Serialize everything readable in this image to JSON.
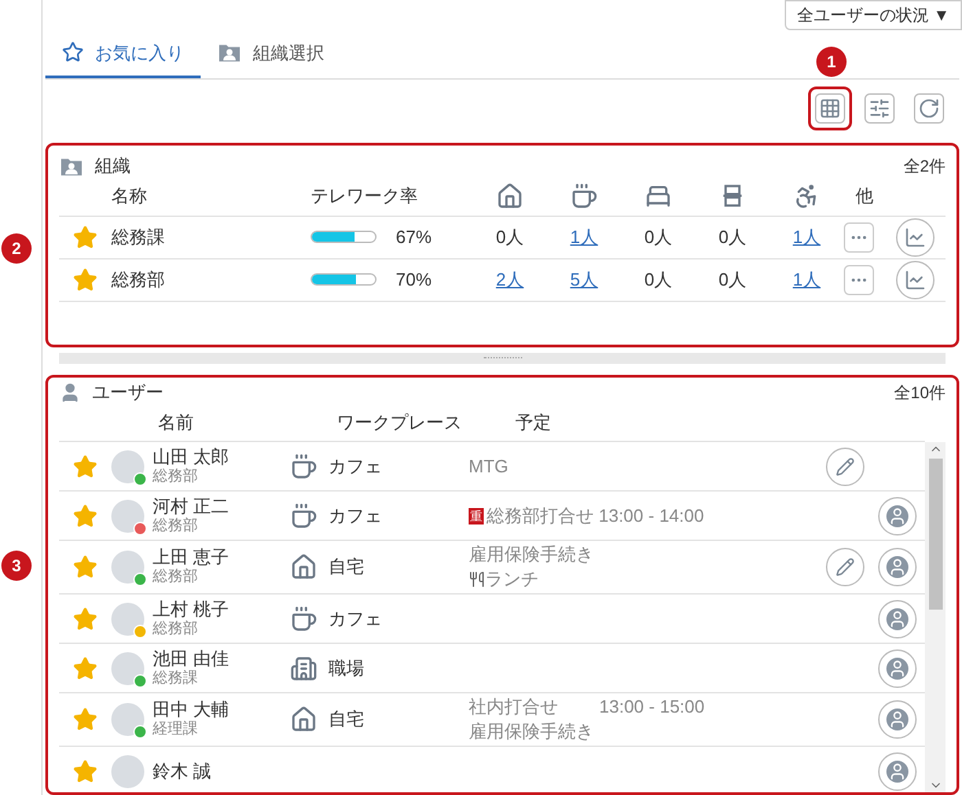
{
  "status_menu": {
    "label": "全ユーザーの状況 ▼"
  },
  "tabs": [
    {
      "label": "お気に入り",
      "kind": "star",
      "selected": true
    },
    {
      "label": "組織選択",
      "kind": "org",
      "selected": false
    }
  ],
  "toolbar": {
    "callout": "1",
    "buttons": [
      {
        "kind": "grid",
        "highlighted": true
      },
      {
        "kind": "filter",
        "highlighted": false
      },
      {
        "kind": "refresh",
        "highlighted": false
      }
    ]
  },
  "org_panel": {
    "callout": "2",
    "title": "組織",
    "count": "全2件",
    "columns": [
      {
        "kind": "text",
        "label": "名称"
      },
      {
        "kind": "text",
        "label": "テレワーク率"
      },
      {
        "kind": "home"
      },
      {
        "kind": "cafe"
      },
      {
        "kind": "bed"
      },
      {
        "kind": "booth"
      },
      {
        "kind": "wheelchair"
      },
      {
        "kind": "text",
        "label": "他"
      }
    ],
    "rows": [
      {
        "favorite": true,
        "name": "総務課",
        "level": 0.67,
        "rate": "67%",
        "counts": [
          {
            "text": "0人",
            "link": false
          },
          {
            "text": "1人",
            "link": true
          },
          {
            "text": "0人",
            "link": false
          },
          {
            "text": "0人",
            "link": false
          },
          {
            "text": "1人",
            "link": true
          }
        ]
      },
      {
        "favorite": true,
        "name": "総務部",
        "level": 0.7,
        "rate": "70%",
        "counts": [
          {
            "text": "2人",
            "link": true
          },
          {
            "text": "5人",
            "link": true
          },
          {
            "text": "0人",
            "link": false
          },
          {
            "text": "0人",
            "link": false
          },
          {
            "text": "1人",
            "link": true
          }
        ]
      }
    ]
  },
  "user_panel": {
    "callout": "3",
    "title": "ユーザー",
    "count": "全10件",
    "columns": [
      "名前",
      "ワークプレース",
      "予定"
    ],
    "rows": [
      {
        "favorite": true,
        "name": "山田 太郎",
        "dept": "総務部",
        "color": "#3bb54a",
        "workplace": {
          "kind": "cafe",
          "label": "カフェ"
        },
        "schedule": [
          {
            "kind": "plain",
            "text": "MTG"
          }
        ],
        "edit": true,
        "chat": false
      },
      {
        "favorite": true,
        "name": "河村 正二",
        "dept": "総務部",
        "color": "#e85a5a",
        "workplace": {
          "kind": "cafe",
          "label": "カフェ"
        },
        "schedule": [
          {
            "kind": "important",
            "badge": "重",
            "text": "総務部打合せ 13:00 - 14:00"
          }
        ],
        "edit": false,
        "chat": true
      },
      {
        "favorite": true,
        "name": "上田 恵子",
        "dept": "総務部",
        "color": "#3bb54a",
        "workplace": {
          "kind": "home",
          "label": "自宅"
        },
        "schedule": [
          {
            "kind": "plain",
            "text": "雇用保険手続き"
          },
          {
            "kind": "lunch",
            "text": "ランチ"
          }
        ],
        "edit": true,
        "chat": true
      },
      {
        "favorite": true,
        "name": "上村 桃子",
        "dept": "総務部",
        "color": "#f2b705",
        "workplace": {
          "kind": "cafe",
          "label": "カフェ"
        },
        "schedule": [],
        "edit": false,
        "chat": true
      },
      {
        "favorite": true,
        "name": "池田 由佳",
        "dept": "総務課",
        "color": "#3bb54a",
        "workplace": {
          "kind": "office",
          "label": "職場"
        },
        "schedule": [],
        "edit": false,
        "chat": true
      },
      {
        "favorite": true,
        "name": "田中 大輔",
        "dept": "経理課",
        "color": "#3bb54a",
        "workplace": {
          "kind": "home",
          "label": "自宅"
        },
        "schedule": [
          {
            "kind": "timed",
            "text": "社内打合せ",
            "time": "13:00 - 15:00"
          },
          {
            "kind": "plain",
            "text": "雇用保険手続き"
          }
        ],
        "edit": false,
        "chat": true
      },
      {
        "favorite": true,
        "name": "鈴木 誠",
        "edit": false,
        "chat": true
      }
    ]
  }
}
